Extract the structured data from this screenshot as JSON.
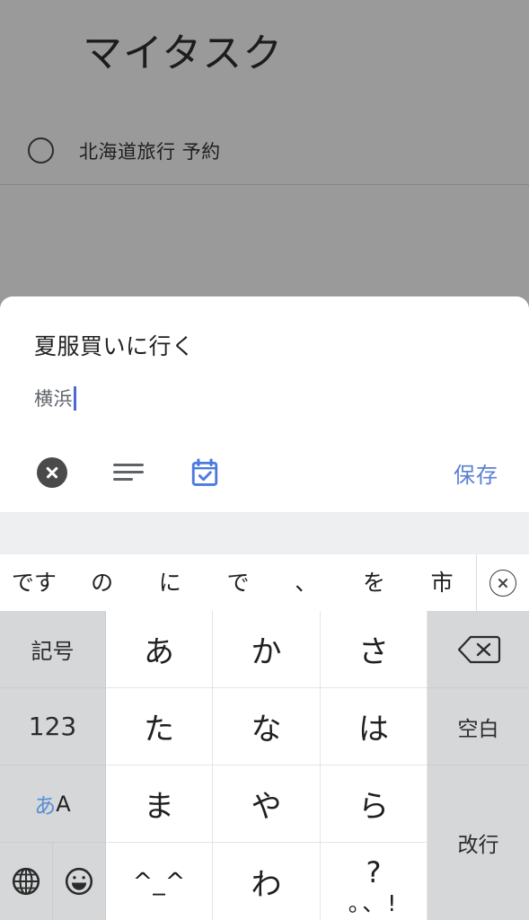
{
  "app": {
    "title": "マイタスク",
    "task_list": [
      {
        "label": "北海道旅行 予約",
        "checkbox_icon": "circle-unchecked-icon"
      }
    ]
  },
  "modal": {
    "title": "夏服買いに行く",
    "subtitle": "横浜",
    "toolbar": {
      "close_icon": "circle-close-icon",
      "details_icon": "details-lines-icon",
      "calendar_icon": "calendar-check-icon",
      "save_label": "保存",
      "save_color": "#5a7fd4"
    }
  },
  "keyboard": {
    "suggestions": [
      "です",
      "の",
      "に",
      "で",
      "、",
      "を",
      "市"
    ],
    "suggestion_close_icon": "circle-close-outline-icon",
    "rows": [
      {
        "left": {
          "label": "記号",
          "name": "key-symbols"
        },
        "chars": [
          "あ",
          "か",
          "さ"
        ],
        "right": {
          "label": "",
          "name": "key-backspace",
          "icon": "backspace-icon"
        }
      },
      {
        "left": {
          "label": "123",
          "name": "key-numbers"
        },
        "chars": [
          "た",
          "な",
          "は"
        ],
        "right": {
          "label": "空白",
          "name": "key-space"
        }
      },
      {
        "left": {
          "label": "あA",
          "name": "key-input-mode",
          "hira": "あ",
          "latin": "A"
        },
        "chars": [
          "ま",
          "や",
          "ら"
        ],
        "right": {
          "label": "改行",
          "name": "key-enter"
        }
      },
      {
        "left": {
          "label": "",
          "name": "key-globe-emoji",
          "globe_icon": "globe-icon",
          "emoji_icon": "emoji-smiley-icon"
        },
        "chars": [
          "^_^",
          "わ"
        ],
        "punct": {
          "top": "?",
          "bottom": "。、!"
        },
        "right": {
          "label": "",
          "name": "key-enter-continued"
        }
      }
    ]
  },
  "colors": {
    "overlay": "#9a9a9a",
    "sheet": "#ffffff",
    "key_bg": "#ffffff",
    "fn_key_bg": "#d5d7d9",
    "accent": "#5a7fd4",
    "cursor": "#4a6bd6"
  }
}
